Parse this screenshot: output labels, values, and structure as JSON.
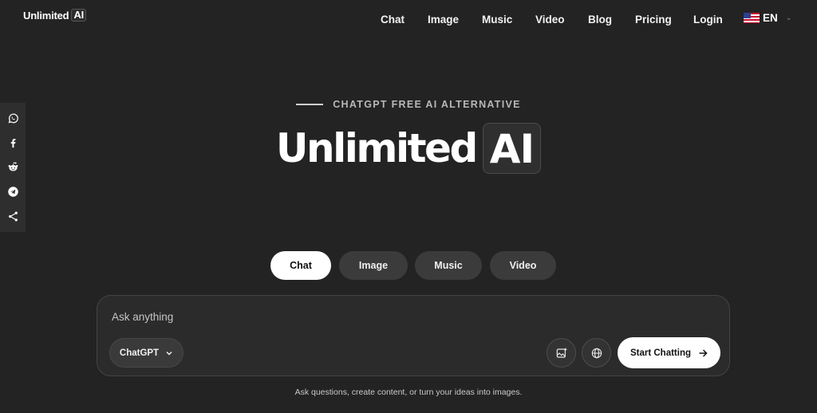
{
  "brand": {
    "name": "Unlimited",
    "badge": "AI"
  },
  "nav": {
    "items": [
      "Chat",
      "Image",
      "Music",
      "Video",
      "Blog",
      "Pricing",
      "Login"
    ],
    "language": "EN"
  },
  "social": [
    "whatsapp-icon",
    "facebook-icon",
    "reddit-icon",
    "telegram-icon",
    "share-icon"
  ],
  "hero": {
    "eyebrow": "CHATGPT FREE AI ALTERNATIVE",
    "title": "Unlimited",
    "title_badge": "AI"
  },
  "modes": {
    "items": [
      "Chat",
      "Image",
      "Music",
      "Video"
    ],
    "active": "Chat"
  },
  "prompt": {
    "placeholder": "Ask anything",
    "model": "ChatGPT",
    "submit_label": "Start Chatting",
    "hint": "Ask questions, create content, or turn your ideas into images."
  },
  "colors": {
    "background": "#232323",
    "panel": "#2b2b2b",
    "accent": "#ffffff"
  }
}
